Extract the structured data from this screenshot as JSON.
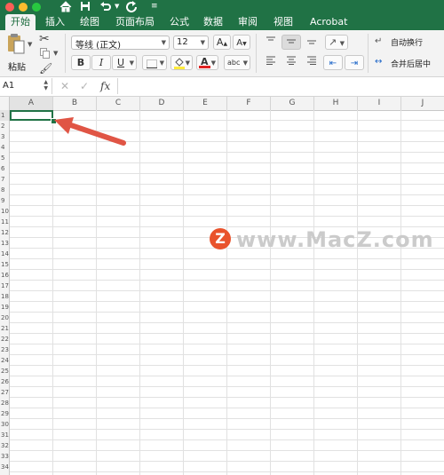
{
  "window": {
    "traffic_lights": [
      "#fe5f57",
      "#febc2e",
      "#28c840"
    ],
    "quick_access": [
      "home-icon",
      "save-icon",
      "undo-icon",
      "redo-icon",
      "customize-icon"
    ]
  },
  "ribbon_tabs": [
    {
      "label": "开始",
      "active": true
    },
    {
      "label": "插入"
    },
    {
      "label": "绘图"
    },
    {
      "label": "页面布局"
    },
    {
      "label": "公式"
    },
    {
      "label": "数据"
    },
    {
      "label": "审阅"
    },
    {
      "label": "视图"
    },
    {
      "label": "Acrobat"
    }
  ],
  "ribbon": {
    "paste_label": "粘贴",
    "font_name": "等线 (正文)",
    "font_size": "12",
    "grow_font": "A",
    "shrink_font": "A",
    "bold": "B",
    "italic": "I",
    "underline": "U",
    "font_color_letter": "A",
    "phonetic": "abc",
    "wrap_text": "自动换行",
    "merge_center": "合并后居中",
    "colors": {
      "accent": "#217346",
      "highlight": "#ffeb3b",
      "font_color": "#e02020"
    }
  },
  "formula_bar": {
    "name_box": "A1",
    "fx": "fx",
    "value": ""
  },
  "grid": {
    "columns": [
      "A",
      "B",
      "C",
      "D",
      "E",
      "F",
      "G",
      "H",
      "I",
      "J"
    ],
    "rows": [
      "1",
      "2",
      "3",
      "4",
      "5",
      "6",
      "7",
      "8",
      "9",
      "10",
      "11",
      "12",
      "13",
      "14",
      "15",
      "16",
      "17",
      "18",
      "19",
      "20",
      "21",
      "22",
      "23",
      "24",
      "25",
      "26",
      "27",
      "28",
      "29",
      "30",
      "31",
      "32",
      "33",
      "34"
    ],
    "selected_cell": "A1"
  },
  "watermark": {
    "logo_letter": "Z",
    "text": "www.MacZ.com"
  }
}
